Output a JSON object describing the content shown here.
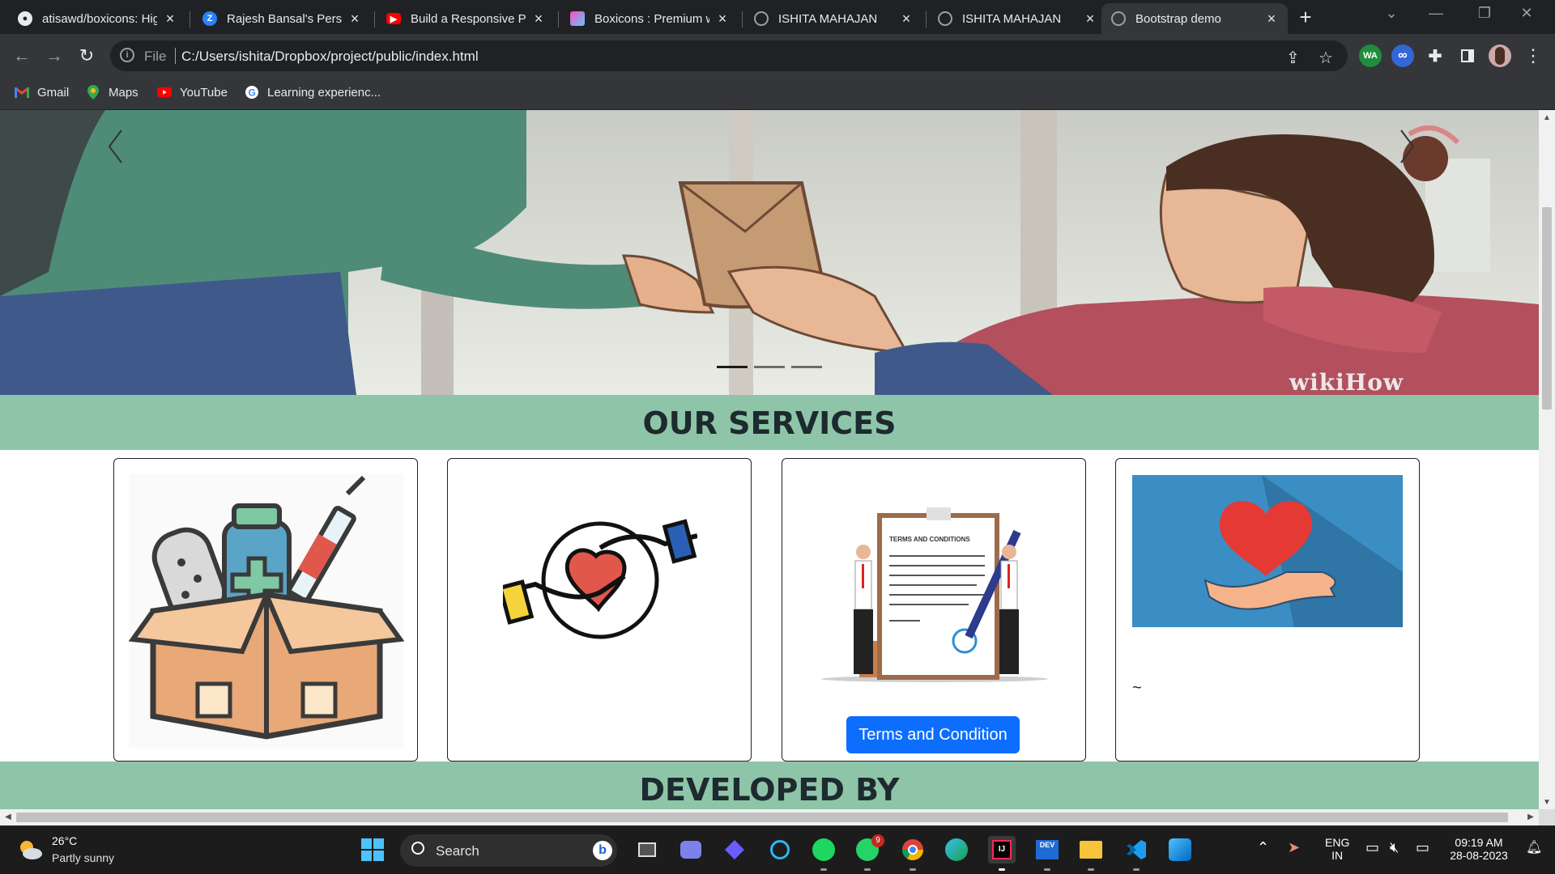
{
  "browser": {
    "tabs": [
      {
        "title": "atisawd/boxicons: Hig",
        "icon": "github-icon"
      },
      {
        "title": "Rajesh Bansal's Persor",
        "icon": "z-icon"
      },
      {
        "title": "Build a Responsive Po",
        "icon": "youtube-icon"
      },
      {
        "title": "Boxicons : Premium w",
        "icon": "boxicons-icon"
      },
      {
        "title": "ISHITA MAHAJAN",
        "icon": "globe-icon"
      },
      {
        "title": "ISHITA MAHAJAN",
        "icon": "globe-icon"
      },
      {
        "title": "Bootstrap demo",
        "icon": "globe-icon"
      }
    ],
    "close_glyph": "×",
    "new_tab_glyph": "+",
    "address": {
      "scheme_label": "File",
      "url": "C:/Users/ishita/Dropbox/project/public/index.html"
    },
    "extensions": [
      {
        "name": "wa-extension-icon",
        "label": "WA",
        "color": "#1e8e3e"
      },
      {
        "name": "infinity-extension-icon",
        "label": "∞",
        "color": "#3367d6"
      }
    ],
    "bookmarks": [
      {
        "label": "Gmail",
        "icon": "gmail-icon"
      },
      {
        "label": "Maps",
        "icon": "maps-icon"
      },
      {
        "label": "YouTube",
        "icon": "youtube-icon"
      },
      {
        "label": "Learning experienc...",
        "icon": "google-icon"
      }
    ]
  },
  "page": {
    "carousel": {
      "active_index": 0,
      "slides_count": 3,
      "watermark": "wikiHow"
    },
    "services_heading": "OUR SERVICES",
    "cards": [
      {
        "icon": "medical-supplies-box-icon"
      },
      {
        "icon": "heart-in-hands-icon"
      },
      {
        "icon": "terms-and-conditions-illustration",
        "illustration_text": "TERMS AND CONDITIONS",
        "button": "Terms and Condition"
      },
      {
        "icon": "heart-over-hand-icon",
        "text": "~"
      }
    ],
    "developed_heading": "DEVELOPED BY"
  },
  "taskbar": {
    "weather": {
      "temp": "26°C",
      "desc": "Partly sunny"
    },
    "search_label": "Search",
    "whatsapp_badge": "9",
    "language": {
      "line1": "ENG",
      "line2": "IN"
    },
    "clock": {
      "time": "09:19 AM",
      "date": "28-08-2023"
    }
  },
  "colors": {
    "band": "#8ec5a8",
    "primary_button": "#0d6efd"
  }
}
